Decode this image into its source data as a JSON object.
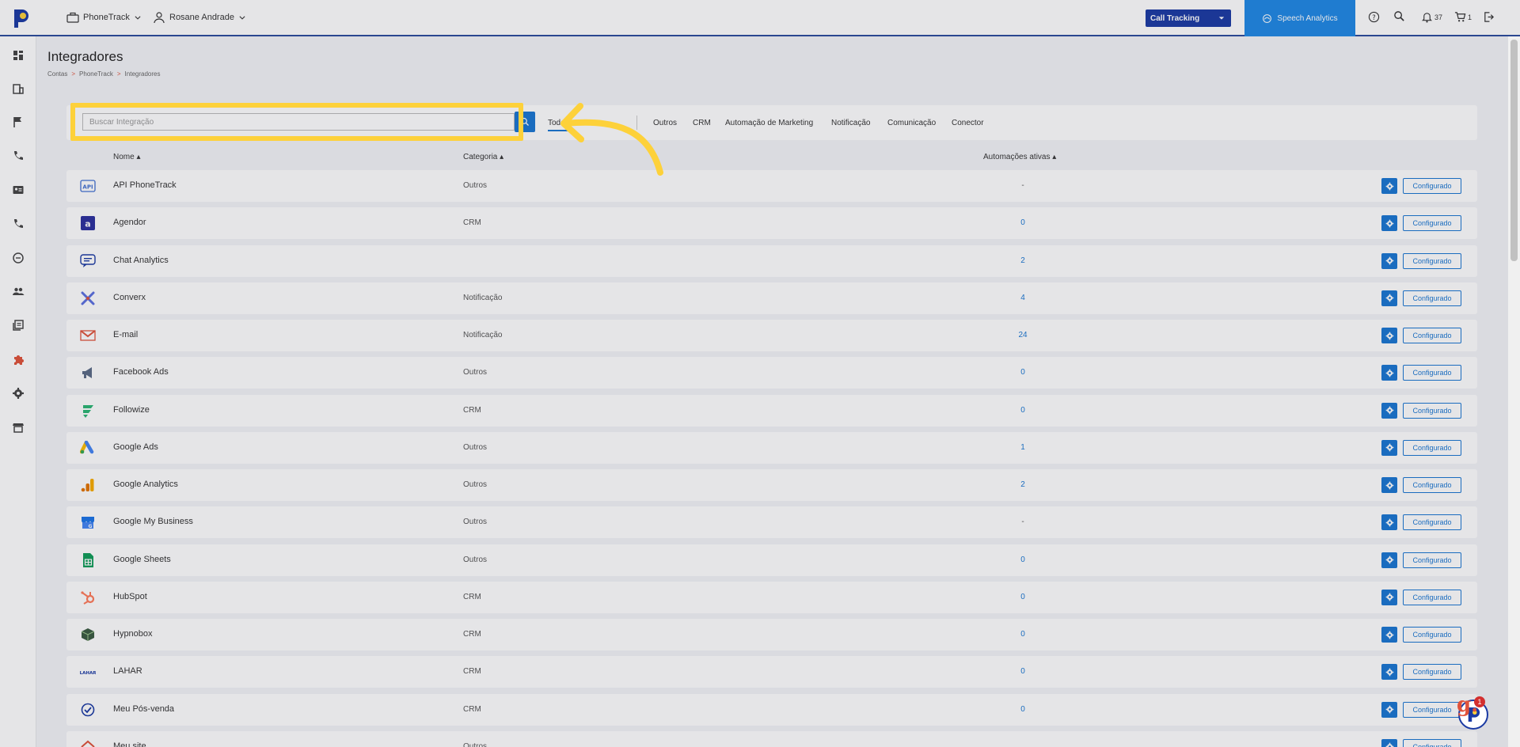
{
  "topbar": {
    "account": "PhoneTrack",
    "user": "Rosane Andrade",
    "call_tracking": "Call Tracking",
    "speech_analytics": "Speech Analytics",
    "notifications_count": "37",
    "cart_count": "1"
  },
  "page": {
    "title": "Integradores",
    "breadcrumb": [
      "Contas",
      "PhoneTrack",
      "Integradores"
    ]
  },
  "search": {
    "placeholder": "Buscar Integração"
  },
  "tabs": [
    {
      "label": "Todos",
      "active": true
    },
    {
      "label": "Outros"
    },
    {
      "label": "CRM"
    },
    {
      "label": "Automação de Marketing"
    },
    {
      "label": "Notificação"
    },
    {
      "label": "Comunicação"
    },
    {
      "label": "Conector"
    }
  ],
  "table": {
    "headers": {
      "name": "Nome ▴",
      "category": "Categoria ▴",
      "automations": "Automações ativas ▴"
    },
    "button_label": "Configurado",
    "rows": [
      {
        "name": "API PhoneTrack",
        "category": "Outros",
        "automations": "-",
        "icon": "api-icon",
        "color": "#3f6fd1"
      },
      {
        "name": "Agendor",
        "category": "CRM",
        "automations": "0",
        "icon": "agendor-logo-icon",
        "color": "#2b2f9e"
      },
      {
        "name": "Chat Analytics",
        "category": "",
        "automations": "2",
        "icon": "chat-icon",
        "color": "#1a3aa3"
      },
      {
        "name": "Converx",
        "category": "Notificação",
        "automations": "4",
        "icon": "converx-logo-icon",
        "color": "#5b6fe0"
      },
      {
        "name": "E-mail",
        "category": "Notificação",
        "automations": "24",
        "icon": "email-icon",
        "color": "#e0523a"
      },
      {
        "name": "Facebook Ads",
        "category": "Outros",
        "automations": "0",
        "icon": "megaphone-icon",
        "color": "#5a6a86"
      },
      {
        "name": "Followize",
        "category": "CRM",
        "automations": "0",
        "icon": "followize-logo-icon",
        "color": "#2bb673"
      },
      {
        "name": "Google Ads",
        "category": "Outros",
        "automations": "1",
        "icon": "google-ads-icon",
        "color": "#4285f4"
      },
      {
        "name": "Google Analytics",
        "category": "Outros",
        "automations": "2",
        "icon": "google-analytics-icon",
        "color": "#f9ab00"
      },
      {
        "name": "Google My Business",
        "category": "Outros",
        "automations": "-",
        "icon": "google-my-business-icon",
        "color": "#4285f4"
      },
      {
        "name": "Google Sheets",
        "category": "Outros",
        "automations": "0",
        "icon": "google-sheets-icon",
        "color": "#0f9d58"
      },
      {
        "name": "HubSpot",
        "category": "CRM",
        "automations": "0",
        "icon": "hubspot-icon",
        "color": "#ff7a59"
      },
      {
        "name": "Hypnobox",
        "category": "CRM",
        "automations": "0",
        "icon": "hypnobox-icon",
        "color": "#3a5a40"
      },
      {
        "name": "LAHAR",
        "category": "CRM",
        "automations": "0",
        "icon": "lahar-logo-icon",
        "color": "#1a3aa3"
      },
      {
        "name": "Meu Pós-venda",
        "category": "CRM",
        "automations": "0",
        "icon": "meu-pos-venda-icon",
        "color": "#1a3aa3"
      },
      {
        "name": "Meu site",
        "category": "Outros",
        "automations": "",
        "icon": "house-icon",
        "color": "#e0523a"
      }
    ]
  },
  "widget": {
    "badge": "1"
  }
}
